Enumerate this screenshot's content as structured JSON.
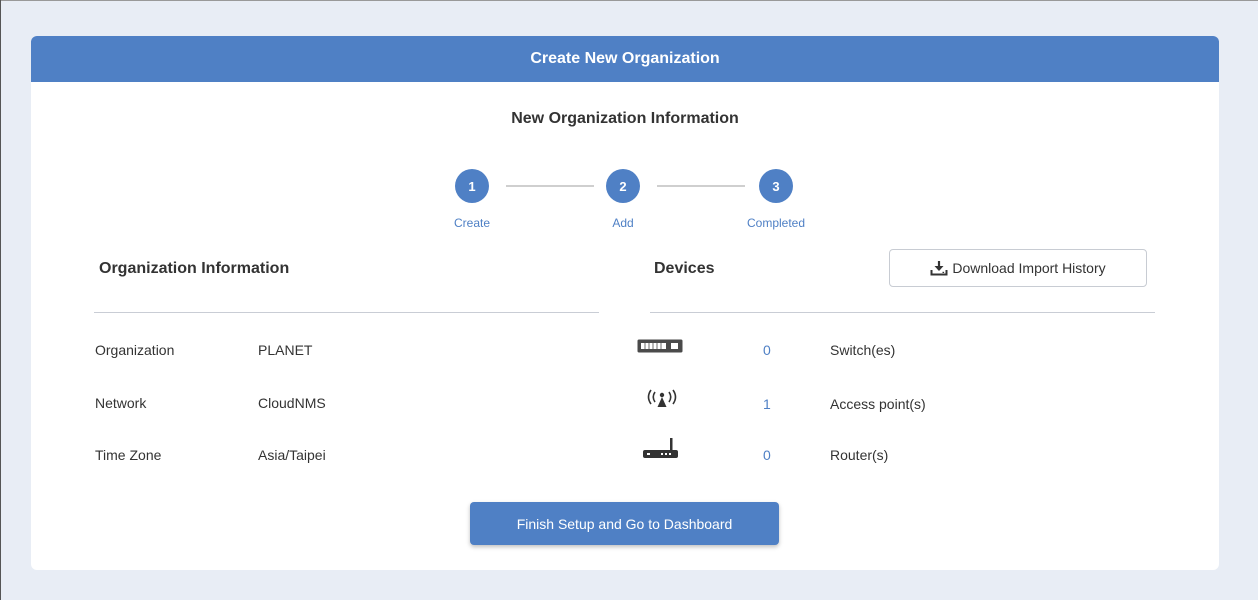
{
  "card": {
    "title": "Create New Organization",
    "subtitle": "New Organization Information"
  },
  "steps": [
    {
      "number": "1",
      "label": "Create"
    },
    {
      "number": "2",
      "label": "Add"
    },
    {
      "number": "3",
      "label": "Completed"
    }
  ],
  "org_info": {
    "title": "Organization Information",
    "rows": [
      {
        "label": "Organization",
        "value": "PLANET"
      },
      {
        "label": "Network",
        "value": "CloudNMS"
      },
      {
        "label": "Time Zone",
        "value": "Asia/Taipei"
      }
    ]
  },
  "devices": {
    "title": "Devices",
    "download_label": "Download Import History",
    "rows": [
      {
        "icon": "switch-icon",
        "count": "0",
        "label": "Switch(es)"
      },
      {
        "icon": "access-point-icon",
        "count": "1",
        "label": "Access point(s)"
      },
      {
        "icon": "router-icon",
        "count": "0",
        "label": "Router(s)"
      }
    ]
  },
  "finish_label": "Finish Setup and Go to Dashboard",
  "colors": {
    "accent": "#4f80c5",
    "background": "#e8edf5"
  }
}
